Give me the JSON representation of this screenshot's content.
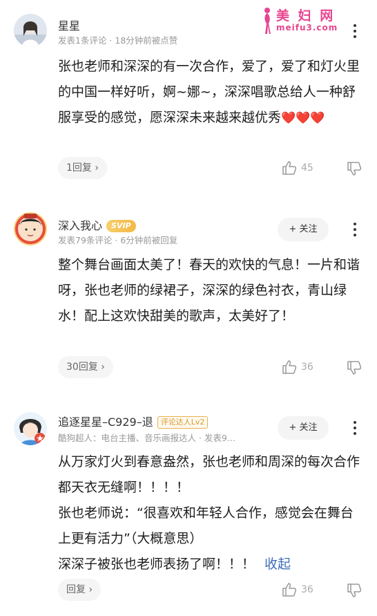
{
  "watermark": {
    "line1": "美 妇 网",
    "line2": "meifu3.com"
  },
  "comments": [
    {
      "username": "星星",
      "meta": "发表1条评论 · 18分钟前被点赞",
      "text": "张也老师和深深的有一次合作，爱了，爱了和灯火里的中国一样好听，婀~娜~，深深唱歌总给人一种舒服享受的感觉，愿深深未来越来越优秀",
      "hearts": "❤️❤️❤️",
      "reply_label": "1回复 ›",
      "likes": "45"
    },
    {
      "username": "深入我心",
      "badge": "SVIP",
      "meta": "发表79条评论 · 6分钟前被回复",
      "follow_label": "+ 关注",
      "text": "整个舞台画面太美了！春天的欢快的气息！一片和谐呀，张也老师的绿裙子，深深的绿色衬衣，青山绿水！配上这欢快甜美的歌声，太美好了！",
      "reply_label": "30回复 ›",
      "likes": "36"
    },
    {
      "username": "追逐星星–C929–退",
      "badge": "评论达人Lv2",
      "meta": "酷狗超人：电台主播、音乐画报达人 · 发表9...",
      "follow_label": "+ 关注",
      "text_line1": "从万家灯火到春意盎然，张也老师和周深的每次合作都天衣无缝啊！！！！",
      "text_line2": "张也老师说：“很喜欢和年轻人合作，感觉会在舞台上更有活力”（大概意思）",
      "text_line3": "深深子被张也老师表扬了啊！！！",
      "collapse_label": "收起",
      "reply_label": "回复 ›",
      "likes": "36"
    }
  ]
}
